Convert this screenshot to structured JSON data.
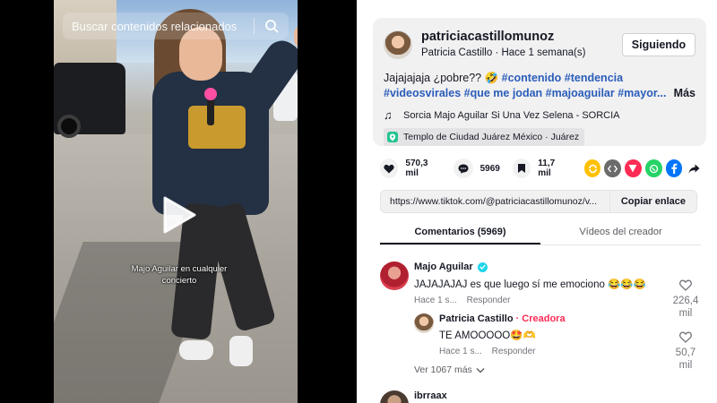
{
  "video": {
    "search_placeholder": "Buscar contenidos relacionados",
    "caption": "Majo Aguilar en cualquier concierto",
    "search_icon": "search-icon",
    "play_icon": "play-icon"
  },
  "post": {
    "author_handle": "patriciacastillomunoz",
    "author_sub": "Patricia Castillo · Hace 1 semana(s)",
    "follow_label": "Siguiendo",
    "desc_text": "Jajajajaja ¿pobre?? 🤣 ",
    "desc_tags_line1": "#contenido #tendencia",
    "desc_tags_line2": "#videosvirales #que me jodan #majoaguilar #mayor...",
    "more_label": "Más",
    "music": "Sorcia Majo Aguilar Si Una Vez Selena - SORCIA",
    "location": "Templo de Ciudad Juárez México · Juárez"
  },
  "actions": {
    "likes": "570,3 mil",
    "comments": "5969",
    "saves": "11,7 mil"
  },
  "share_colors": {
    "friends": "#FFC107",
    "embed": "#6b6b6b",
    "send": "#fe2c55",
    "whatsapp": "#25D366",
    "facebook": "#0075FA"
  },
  "link": {
    "url": "https://www.tiktok.com/@patriciacastillomunoz/v...",
    "copy_label": "Copiar enlace"
  },
  "tabs": {
    "comments": "Comentarios (5969)",
    "creator_videos": "Vídeos del creador"
  },
  "comments": [
    {
      "name": "Majo Aguilar",
      "text": "JAJAJAJAJ es que luego sí me emociono 😂😂😂",
      "time": "Hace 1 s...",
      "reply": "Responder",
      "likes_line1": "226,4",
      "likes_line2": "mil"
    },
    {
      "name": "Patricia Castillo",
      "badge": "· Creadora",
      "text": "TE AMOOOOO🤩🫶",
      "time": "Hace 1 s...",
      "reply": "Responder",
      "likes_line1": "50,7",
      "likes_line2": "mil"
    },
    {
      "name": "ibrraax"
    }
  ],
  "view_more": "Ver 1067 más"
}
